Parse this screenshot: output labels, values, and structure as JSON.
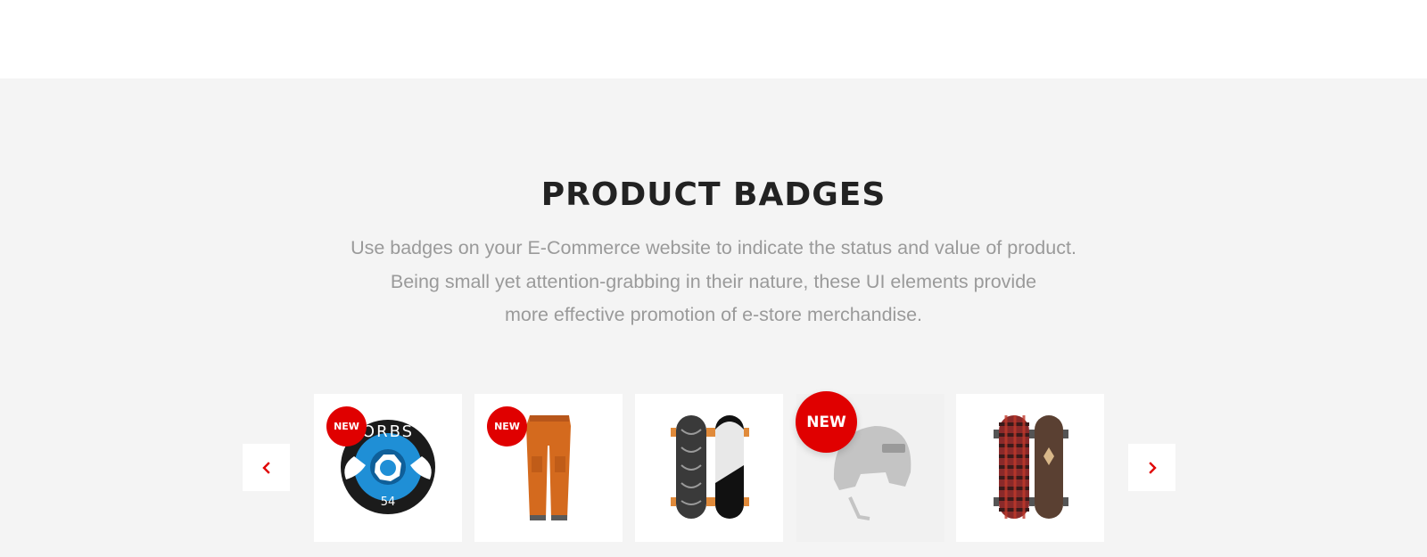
{
  "section": {
    "title": "PRODUCT BADGES",
    "description_lines": [
      "Use badges on your E-Commerce website to indicate the status and value of product.",
      "Being small yet attention-grabbing in their nature, these UI elements provide",
      "more effective promotion of e-store merchandise."
    ]
  },
  "carousel": {
    "prev_icon": "chevron-left-icon",
    "next_icon": "chevron-right-icon",
    "accent_color": "#e00000",
    "items": [
      {
        "product": "skateboard wheel",
        "badge": "NEW"
      },
      {
        "product": "orange snow pants",
        "badge": "NEW"
      },
      {
        "product": "two cruiser skateboards",
        "badge": ""
      },
      {
        "product": "helmet",
        "badge": "NEW"
      },
      {
        "product": "two longboards",
        "badge": ""
      }
    ]
  }
}
